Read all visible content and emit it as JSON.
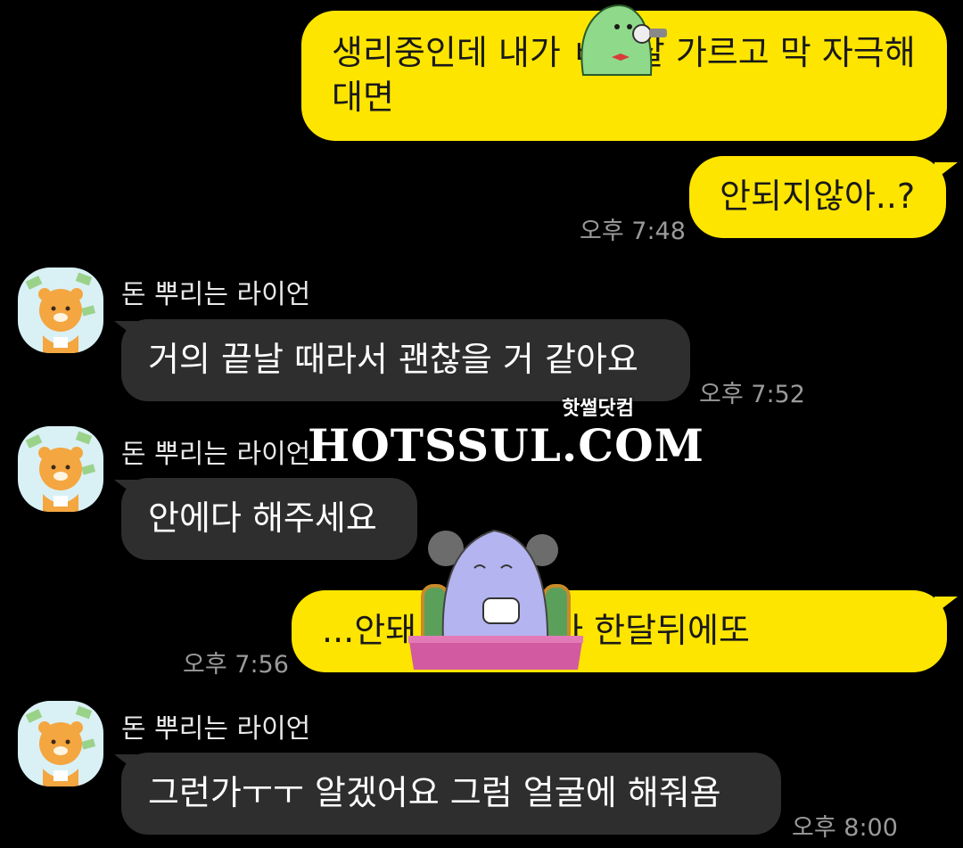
{
  "messages": [
    {
      "id": "m1",
      "side": "out",
      "text": "생리중인데 내가 ㅂㅈ살 가르고 막 자극해대면"
    },
    {
      "id": "m2",
      "side": "out",
      "text": "안되지않아..?",
      "time": "오후 7:48"
    },
    {
      "id": "m3",
      "side": "in",
      "sender": "돈 뿌리는 라이언",
      "text": "거의 끝날 때라서 괜찮을 거 같아요",
      "time": "오후 7:52"
    },
    {
      "id": "m4",
      "side": "in",
      "sender": "돈 뿌리는 라이언",
      "text": "안에다 해주세요"
    },
    {
      "id": "m5",
      "side": "out",
      "text": "...안돼 걱정되잖아 한달뒤에또",
      "time": "오후 7:56"
    },
    {
      "id": "m6",
      "side": "in",
      "sender": "돈 뿌리는 라이언",
      "text": "그런가ㅜㅜ 알겠어요 그럼 얼굴에 해줘욤",
      "time": "오후 8:00"
    }
  ],
  "watermark": {
    "main": "HOTSSUL.COM",
    "sub": "핫썰닷컴"
  },
  "colors": {
    "background": "#000000",
    "outgoing": "#FEE500",
    "incoming": "#2e2e2e",
    "time": "#9a9a9a"
  },
  "icons": {
    "avatar": "ryan-money-avatar-icon",
    "sticker1": "green-character-sticker-icon",
    "sticker2": "purple-tea-character-sticker-icon"
  }
}
